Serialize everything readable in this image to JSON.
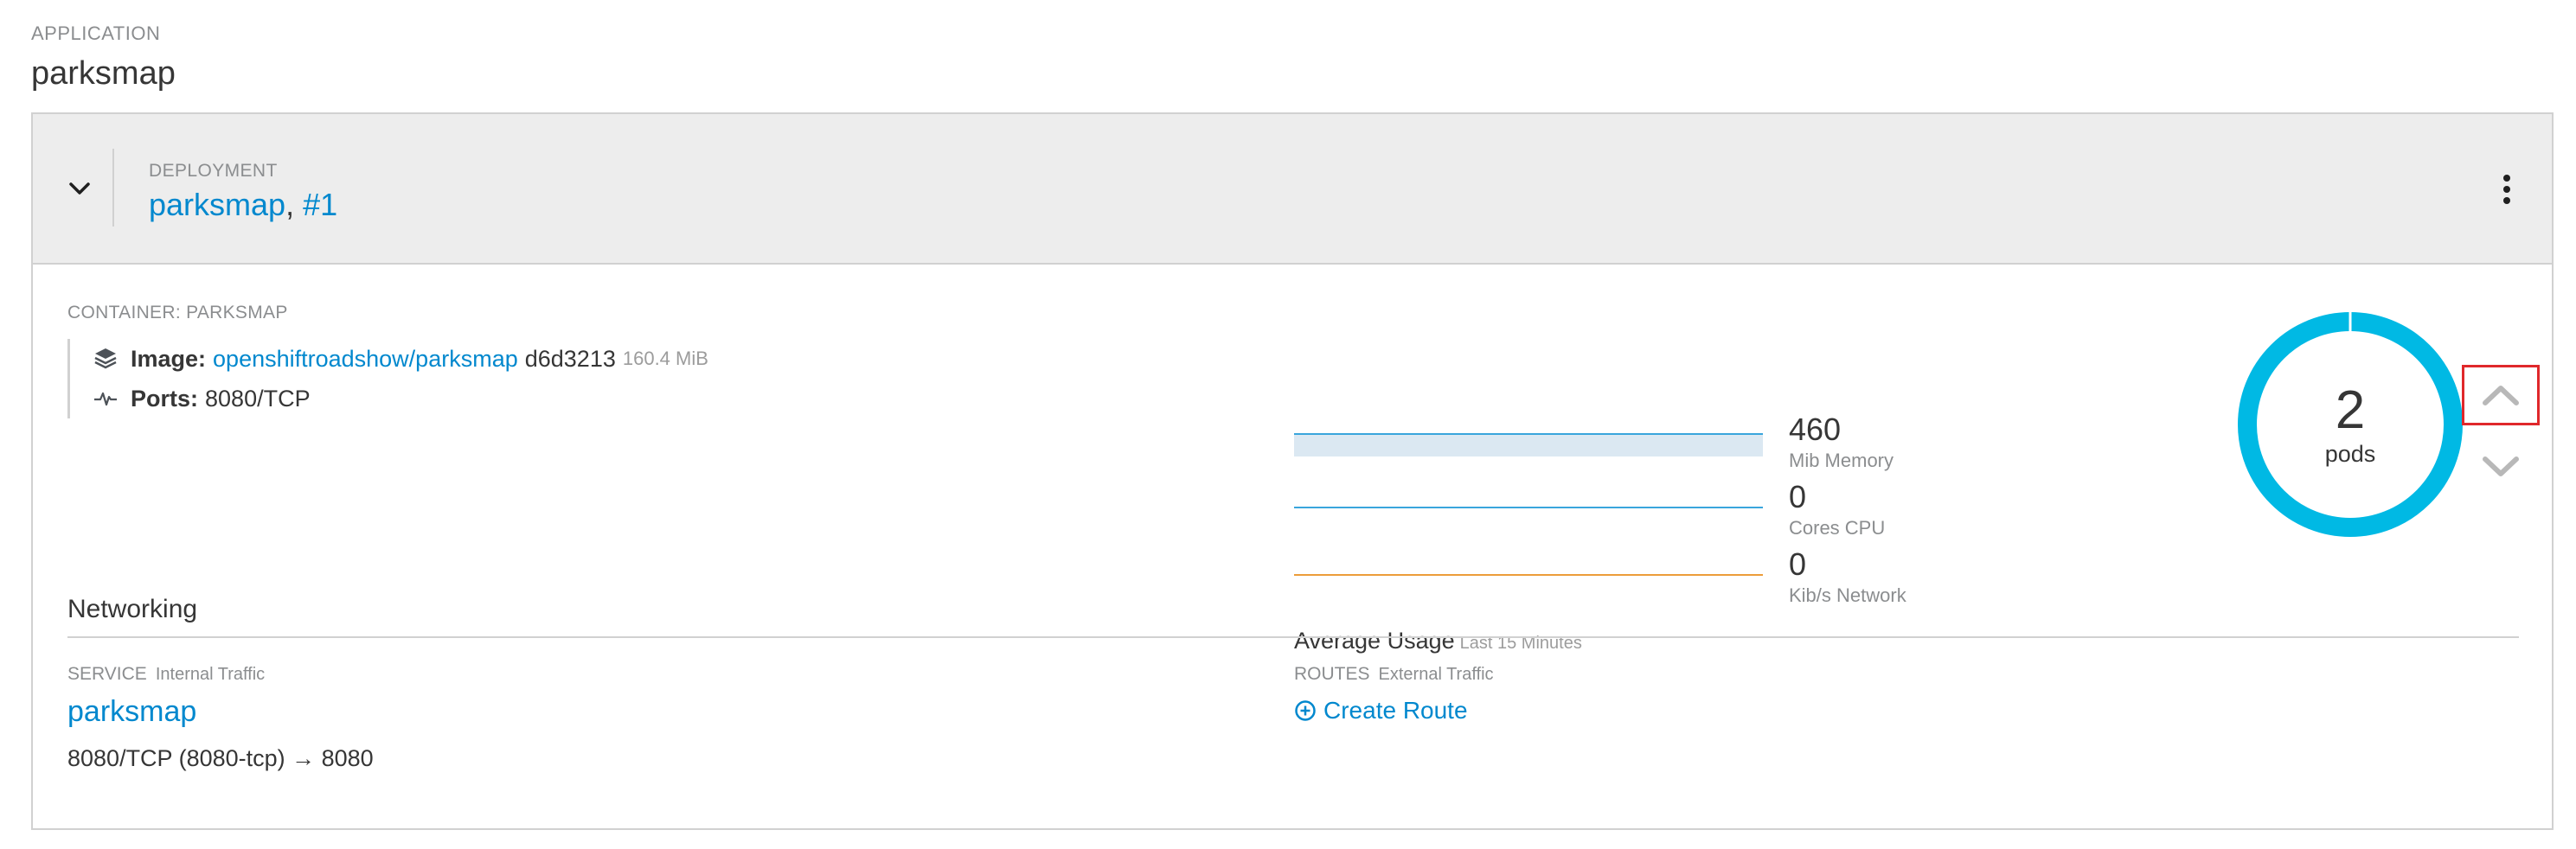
{
  "application": {
    "kicker": "APPLICATION",
    "name": "parksmap"
  },
  "deployment": {
    "kicker": "DEPLOYMENT",
    "name": "parksmap",
    "separator": ", ",
    "revision": "#1"
  },
  "container": {
    "label": "CONTAINER: PARKSMAP",
    "image_label": "Image:",
    "image_link": "openshiftroadshow/parksmap",
    "image_id": "d6d3213",
    "image_size": "160.4 MiB",
    "ports_label": "Ports:",
    "ports_value": "8080/TCP"
  },
  "metrics": {
    "memory": {
      "value": "460",
      "unit": "Mib Memory"
    },
    "cpu": {
      "value": "0",
      "unit": "Cores CPU"
    },
    "network": {
      "value": "0",
      "unit": "Kib/s Network"
    },
    "avg_label": "Average Usage",
    "avg_period": "Last 15 Minutes"
  },
  "pods": {
    "count": "2",
    "label": "pods"
  },
  "networking": {
    "title": "Networking",
    "service_label": "SERVICE",
    "service_sub": "Internal Traffic",
    "service_name": "parksmap",
    "service_port": "8080/TCP (8080-tcp) → 8080",
    "routes_label": "ROUTES",
    "routes_sub": "External Traffic",
    "create_route": "Create Route"
  },
  "colors": {
    "link": "#0088ce",
    "donut": "#00b9e4",
    "memory_line": "#39a5dc",
    "memory_fill": "#dbe8f2",
    "network_line": "#ec9d3a",
    "highlight": "#e0282b"
  },
  "icons": [
    "chevron-down-icon",
    "kebab-icon",
    "layers-icon",
    "pulse-icon",
    "chevron-up-icon",
    "plus-circle-icon"
  ]
}
